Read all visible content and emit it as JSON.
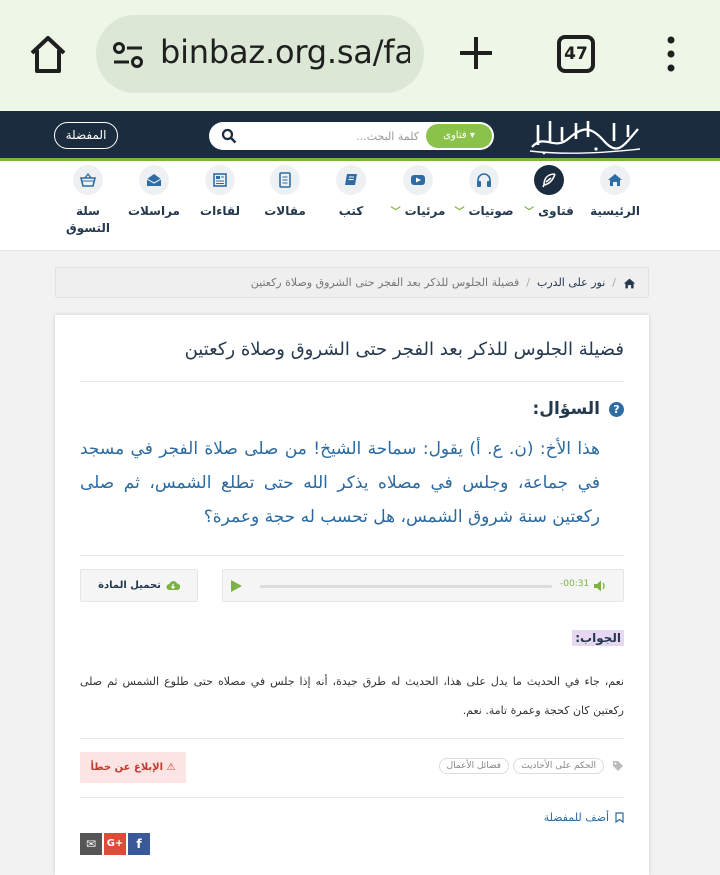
{
  "browser": {
    "url": "binbaz.org.sa/fat",
    "tab_count": "47"
  },
  "header": {
    "favorites_label": "المفضلة",
    "search_placeholder": "كلمة البحث...",
    "search_type_label": "فتاوى",
    "logo_alt": "الإمام ابن باز"
  },
  "nav": {
    "items": [
      {
        "label": "الرئيسية",
        "icon": "home-icon"
      },
      {
        "label": "فتاوى",
        "icon": "feather-icon",
        "caret": true,
        "active": true
      },
      {
        "label": "صوتيات",
        "icon": "headphones-icon",
        "caret": true
      },
      {
        "label": "مرئيات",
        "icon": "youtube-icon",
        "caret": true
      },
      {
        "label": "كتب",
        "icon": "book-icon"
      },
      {
        "label": "مقالات",
        "icon": "document-icon"
      },
      {
        "label": "لقاءات",
        "icon": "newspaper-icon"
      },
      {
        "label": "مراسلات",
        "icon": "envelope-open-icon"
      },
      {
        "label": "سلة التسوق",
        "icon": "basket-icon"
      }
    ]
  },
  "breadcrumb": {
    "items": [
      "نور على الدرب",
      "فضيلة الجلوس للذكر بعد الفجر حتى الشروق وصلاة ركعتين"
    ]
  },
  "article": {
    "title": "فضيلة الجلوس للذكر بعد الفجر حتى الشروق وصلاة ركعتين",
    "question_label": "السؤال:",
    "question_text": "هذا الأخ: (ن. ع. أ) يقول: سماحة الشيخ! من صلى صلاة الفجر في مسجد في جماعة، وجلس في مصلاه يذكر الله حتى تطلع الشمس، ثم صلى ركعتين سنة شروق الشمس، هل تحسب له حجة وعمرة؟",
    "player_time": "-00:31",
    "download_label": "تحميل المادة",
    "answer_label": "الجواب:",
    "answer_text": "نعم، جاء في الحديث ما يدل على هذا، الحديث له طرق جيدة، أنه إذا جلس في مصلاه حتى طلوع الشمس ثم صلى ركعتين كان كحجة وعمرة تامة. نعم.",
    "tags": [
      "الحكم على الأحاديث",
      "فضائل الأعمال"
    ],
    "report_label": "⚠ الإبلاغ عن خطأ",
    "add_favorite_label": "أضف للمفضلة",
    "share": [
      {
        "name": "facebook",
        "label": "f",
        "color": "#3b5998"
      },
      {
        "name": "googleplus",
        "label": "G+",
        "color": "#dd4b39"
      },
      {
        "name": "email",
        "label": "✉",
        "color": "#555555"
      }
    ]
  },
  "colors": {
    "header_bg": "#1b2c3e",
    "accent_green": "#7cb342",
    "text_blue": "#2a6aa0",
    "title_navy": "#24384e"
  }
}
